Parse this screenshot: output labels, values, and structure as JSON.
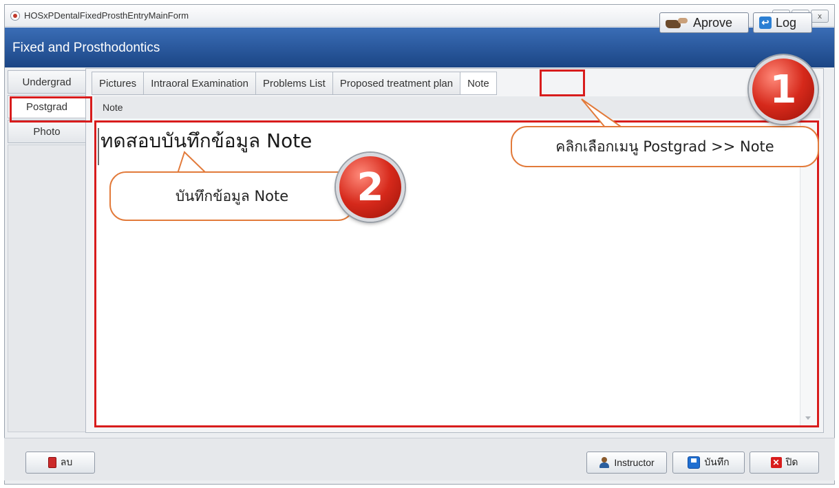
{
  "window": {
    "title": "HOSxPDentalFixedProsthEntryMainForm",
    "controls": {
      "minimize": "_",
      "maximize": "□",
      "close": "x"
    }
  },
  "header": {
    "title": "Fixed and Prosthodontics",
    "approve_label": "Aprove",
    "log_label": "Log"
  },
  "side_tabs": [
    {
      "label": "Undergrad"
    },
    {
      "label": "Postgrad"
    },
    {
      "label": "Photo"
    }
  ],
  "top_tabs": [
    {
      "label": "Pictures"
    },
    {
      "label": "Intraoral Examination"
    },
    {
      "label": "Problems List"
    },
    {
      "label": "Proposed treatment plan"
    },
    {
      "label": "Note"
    }
  ],
  "note": {
    "caption": "Note",
    "text": "ทดสอบบันทึกข้อมูล Note"
  },
  "annotations": {
    "step1": {
      "number": "1",
      "text": "คลิกเลือกเมนู Postgrad >> Note"
    },
    "step2": {
      "number": "2",
      "text": "บันทึกข้อมูล Note"
    }
  },
  "footer": {
    "delete_label": "ลบ",
    "instructor_label": "Instructor",
    "save_label": "บันทึก",
    "close_label": "ปิด"
  },
  "colors": {
    "header": "#1b4585",
    "highlight": "#d81c1c",
    "callout_border": "#e27a3a"
  }
}
